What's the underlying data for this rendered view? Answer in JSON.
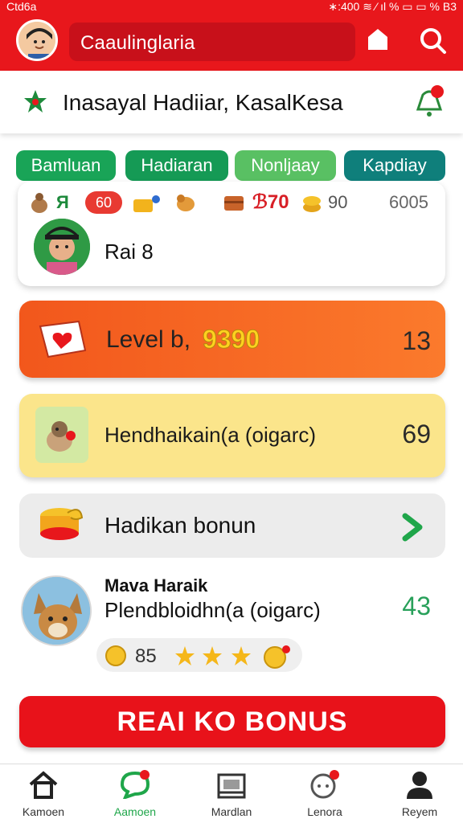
{
  "statusbar": {
    "left_text": "Ctd6a",
    "right_text": "∗:400 ≋ ⁄ ıl % ▭ ▭ % B3"
  },
  "topbar": {
    "search_text": "Caaulinglaria"
  },
  "header": {
    "title": "Inasayal Hadiiar, KasalKesa"
  },
  "chips": [
    {
      "label": "Bamluan",
      "color": "#19a457"
    },
    {
      "label": "Hadiaran",
      "color": "#159a55"
    },
    {
      "label": "Nonljaay",
      "color": "#59c063"
    },
    {
      "label": "Kapdiay",
      "color": "#0f7f7b"
    }
  ],
  "stats": {
    "badge_letter": "Я",
    "badge_value": "60",
    "val1": "ℬ70",
    "val2": "90",
    "val3": "6005"
  },
  "user": {
    "name": "Rai 8"
  },
  "level_card": {
    "label": "Level b,",
    "score": "9390",
    "number": "13"
  },
  "yellow_card": {
    "label": "Hendhaikain(a (oigarc)",
    "number": "69"
  },
  "bonus_card": {
    "label": "Hadikan bonun"
  },
  "friend": {
    "name": "Mava Haraik",
    "subtitle": "Plendbloidhn(a (oigarc)",
    "number": "43",
    "rating_value": "85"
  },
  "cta": {
    "label": "REAI KO BONUS"
  },
  "nav": [
    {
      "label": "Kamoen"
    },
    {
      "label": "Aamoen",
      "active": true
    },
    {
      "label": "Mardlan"
    },
    {
      "label": "Lenora"
    },
    {
      "label": "Reyem"
    }
  ],
  "colors": {
    "brand_red": "#e8171c",
    "level_orange": "#f2571c",
    "card_yellow": "#fbe58b",
    "accent_green": "#1fa64a"
  }
}
